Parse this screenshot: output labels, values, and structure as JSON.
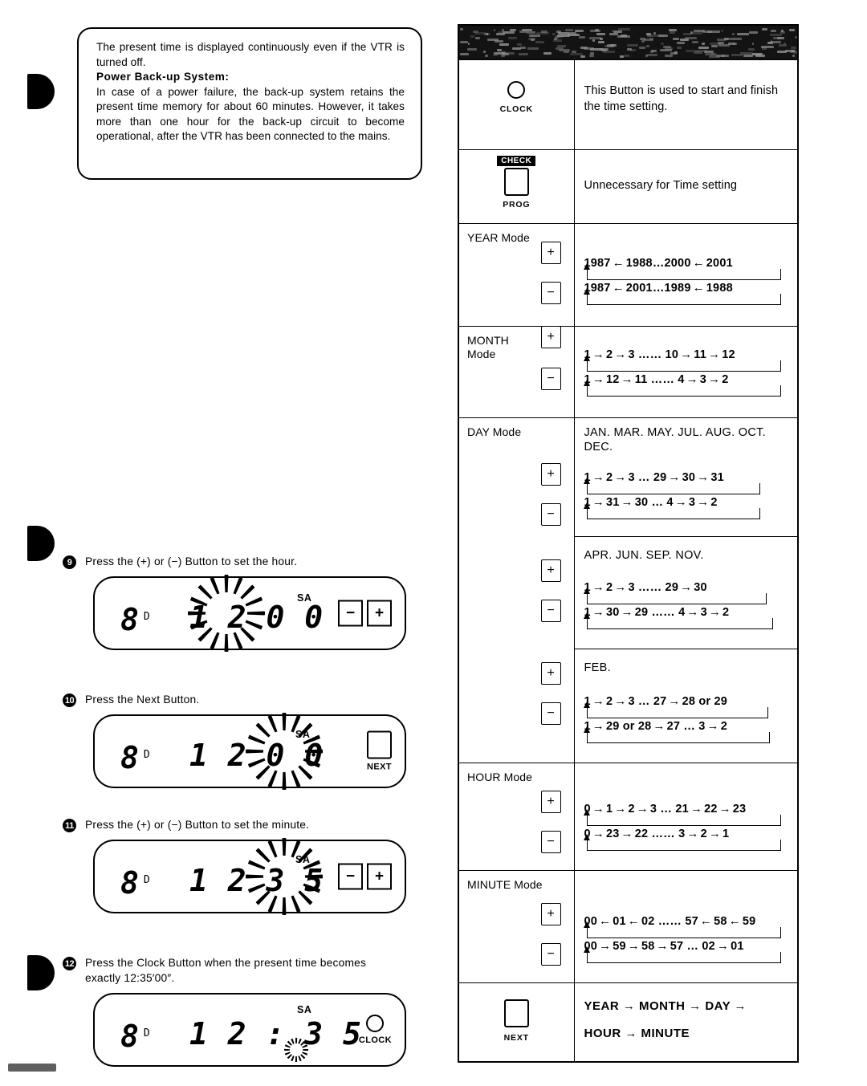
{
  "note": {
    "lines": [
      "The present time is displayed continuously even if the VTR is turned off.",
      "Power Back-up System:",
      "In case of a power failure, the back-up system retains the present time memory for about 60 minutes. However, it takes more than one hour for the back-up circuit to become operational, after the VTR has been connected to the mains."
    ]
  },
  "steps": [
    {
      "num": "9",
      "text": "Press the (+) or (−) Button to set the hour.",
      "display": {
        "prog": "8",
        "prog_sub": "D",
        "time": "1 2 0 0",
        "sa": "SA"
      },
      "buttons": [
        {
          "type": "minus",
          "label": "−"
        },
        {
          "type": "plus",
          "label": "+"
        }
      ]
    },
    {
      "num": "10",
      "text": "Press the Next Button.",
      "display": {
        "prog": "8",
        "prog_sub": "D",
        "time": "1 2 0 0",
        "sa": "SA"
      },
      "buttons": [
        {
          "type": "square",
          "label": "NEXT"
        }
      ]
    },
    {
      "num": "11",
      "text": "Press the (+) or (−) Button to set the minute.",
      "display": {
        "prog": "8",
        "prog_sub": "D",
        "time": "1 2 3 5",
        "sa": "SA"
      },
      "buttons": [
        {
          "type": "minus",
          "label": "−"
        },
        {
          "type": "plus",
          "label": "+"
        }
      ]
    },
    {
      "num": "12",
      "text": "Press the Clock Button when the present time becomes exactly 12:35′00″.",
      "display": {
        "prog": "8",
        "prog_sub": "D",
        "time": "1 2 : 3 5",
        "sa": "SA"
      },
      "buttons": [
        {
          "type": "circle",
          "label": "CLOCK"
        }
      ]
    }
  ],
  "table": {
    "header": {
      "text": ""
    },
    "rows": {
      "clock": {
        "button_label": "CLOCK",
        "description": "This Button is used to start and finish the time setting."
      },
      "prog": {
        "badge": "CHECK",
        "button_label": "PROG",
        "description": "Unnecessary for Time setting"
      },
      "year": {
        "mode": "YEAR Mode",
        "plus_label": "+",
        "minus_label": "−",
        "plus_seq": "1987 ← 1988 … 2000 ← 2001",
        "plus_parts": [
          "1987",
          "1988…2000",
          "2001"
        ],
        "minus_seq": "1987 ← 2001 … 1989 ← 1988",
        "minus_parts": [
          "1987",
          "2001…1989",
          "1988"
        ]
      },
      "month": {
        "mode_l1": "MONTH",
        "mode_l2": "Mode",
        "plus_label": "+",
        "minus_label": "−",
        "plus_parts": [
          "1",
          "2",
          "3 …… 10",
          "11",
          "12"
        ],
        "minus_parts": [
          "1",
          "12",
          "11 …… 4",
          "3",
          "2"
        ]
      },
      "day": {
        "mode": "DAY Mode",
        "plus_label": "+",
        "minus_label": "−",
        "groups": [
          {
            "title": "JAN. MAR. MAY. JUL. AUG. OCT. DEC.",
            "plus_parts": [
              "1",
              "2",
              "3 … 29",
              "30",
              "31"
            ],
            "minus_parts": [
              "1",
              "31",
              "30 … 4",
              "3",
              "2"
            ]
          },
          {
            "title": "APR. JUN. SEP. NOV.",
            "plus_parts": [
              "1",
              "2",
              "3 …… 29",
              "30"
            ],
            "minus_parts": [
              "1",
              "30",
              "29 …… 4",
              "3",
              "2"
            ]
          },
          {
            "title": "FEB.",
            "plus_parts": [
              "1",
              "2",
              "3 … 27",
              "28 or 29"
            ],
            "minus_parts": [
              "1",
              "29 or 28",
              "27 … 3",
              "2"
            ]
          }
        ]
      },
      "hour": {
        "mode": "HOUR Mode",
        "plus_label": "+",
        "minus_label": "−",
        "plus_parts": [
          "0",
          "1",
          "2",
          "3 … 21",
          "22",
          "23"
        ],
        "minus_parts": [
          "0",
          "23",
          "22 …… 3",
          "2",
          "1"
        ]
      },
      "minute": {
        "mode": "MINUTE Mode",
        "plus_label": "+",
        "minus_label": "−",
        "plus_parts": [
          "00",
          "01",
          "02 …… 57",
          "58",
          "59"
        ],
        "minus_parts": [
          "00",
          "59",
          "58",
          "57 … 02",
          "01"
        ]
      },
      "next": {
        "button_label": "NEXT",
        "flow_line1": "YEAR → MONTH → DAY →",
        "flow_line2": "HOUR → MINUTE"
      }
    }
  }
}
